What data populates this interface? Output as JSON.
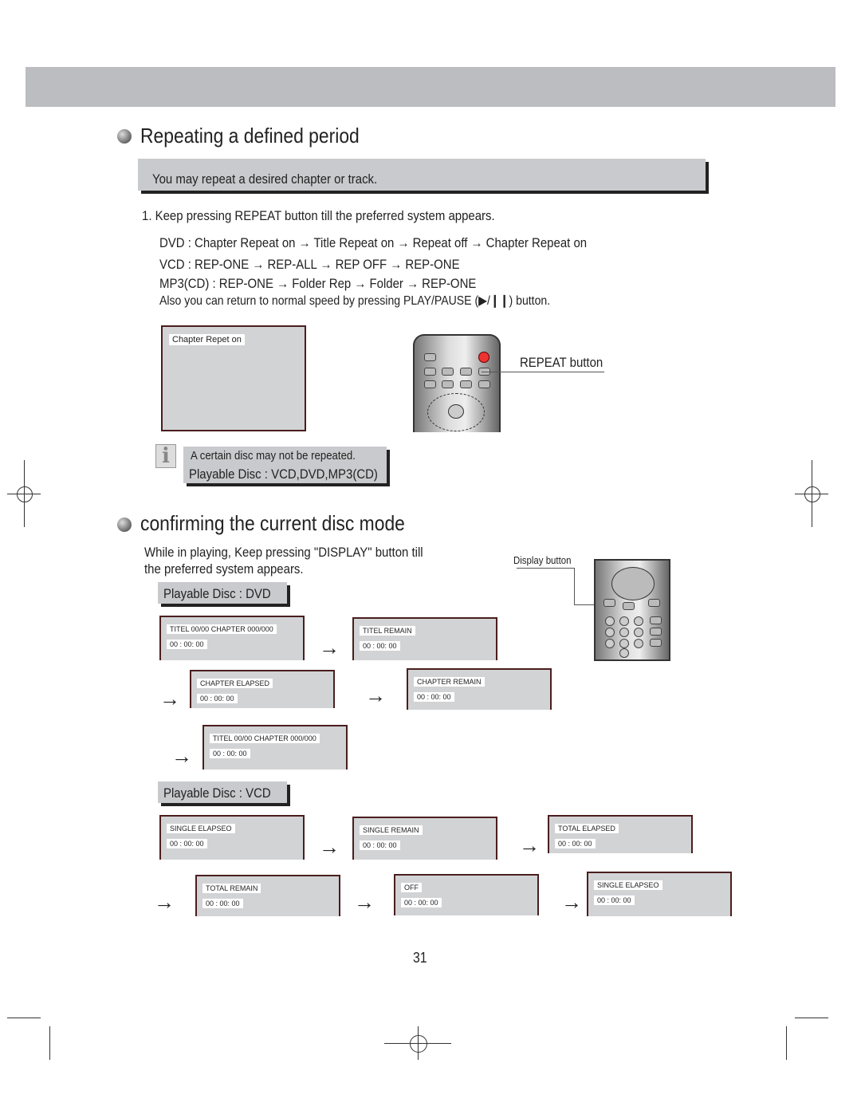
{
  "section1": {
    "title": "Repeating a defined period",
    "banner": "You may repeat a desired chapter or track.",
    "step": "1. Keep pressing REPEAT button till the preferred system appears.",
    "lines": [
      "DVD : Chapter Repeat on → Title Repeat on → Repeat off → Chapter Repeat on",
      "VCD : REP-ONE → REP-ALL → REP OFF → REP-ONE",
      "MP3(CD) : REP-ONE → Folder Rep → Folder → REP-ONE",
      "Also you can return to normal speed by pressing PLAY/PAUSE (▶/❙❙) button."
    ],
    "screen_label": "Chapter Repet on",
    "repeat_callout": "REPEAT button",
    "info_line1": "A certain disc may not be repeated.",
    "info_line2": "Playable Disc  : VCD,DVD,MP3(CD)"
  },
  "section2": {
    "title": "confirming the current disc mode",
    "intro1": "While in playing, Keep pressing \"DISPLAY\" button till",
    "intro2": "the preferred system appears.",
    "display_callout": "Display button",
    "dvd_label": "Playable Disc  : DVD",
    "dvd_screens": [
      {
        "label": "TITEL 00/00 CHAPTER 000/000",
        "time": "00 : 00: 00"
      },
      {
        "label": "TITEL REMAIN",
        "time": "00 : 00: 00"
      },
      {
        "label": "CHAPTER ELAPSED",
        "time": "00 : 00: 00"
      },
      {
        "label": "CHAPTER REMAIN",
        "time": "00 : 00: 00"
      },
      {
        "label": "TITEL 00/00 CHAPTER 000/000",
        "time": "00 : 00: 00"
      }
    ],
    "vcd_label": "Playable Disc  : VCD",
    "vcd_screens": [
      {
        "label": "SINGLE ELAPSEO",
        "time": "00 : 00: 00"
      },
      {
        "label": "SINGLE REMAIN",
        "time": "00 : 00: 00"
      },
      {
        "label": "TOTAL ELAPSED",
        "time": "00 : 00: 00"
      },
      {
        "label": "TOTAL REMAIN",
        "time": "00 : 00: 00"
      },
      {
        "label": "OFF",
        "time": "00 : 00: 00"
      },
      {
        "label": "SINGLE ELAPSEO",
        "time": "00 : 00: 00"
      }
    ]
  },
  "page_number": "31",
  "arrow": "→"
}
